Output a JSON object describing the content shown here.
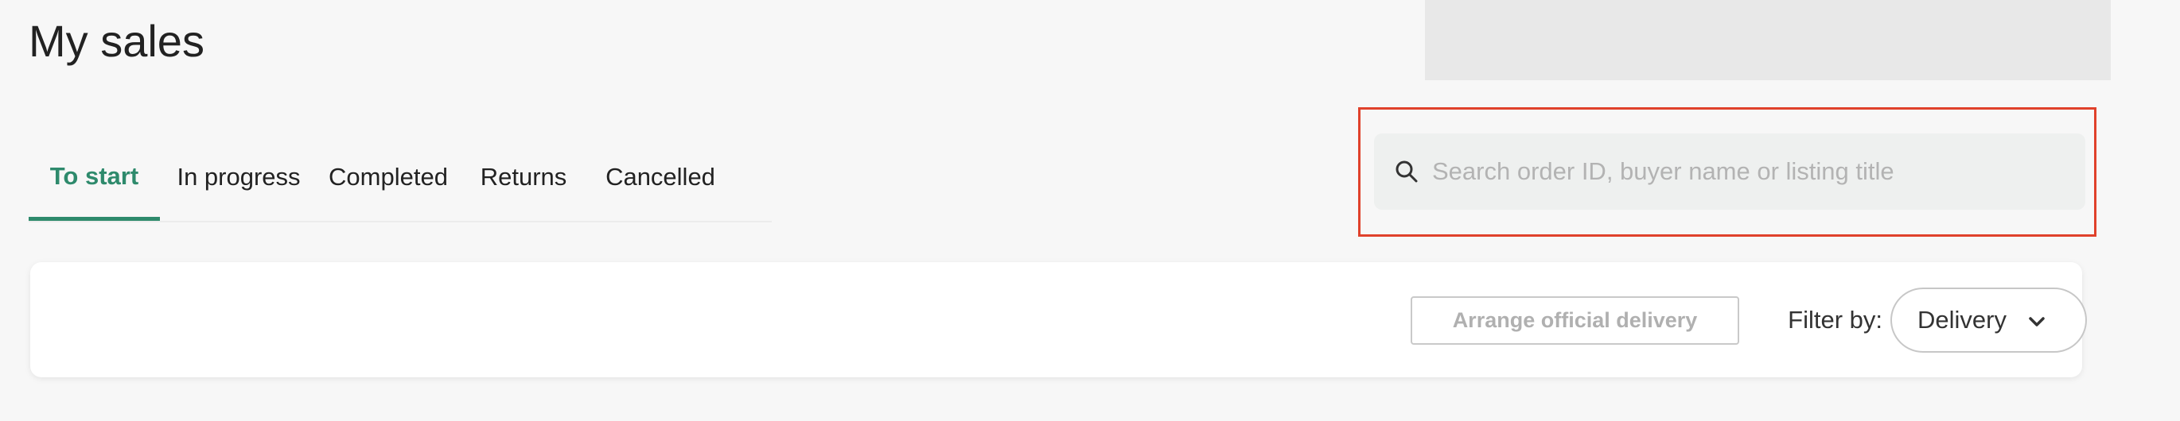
{
  "page": {
    "title": "My sales"
  },
  "tabs": [
    {
      "label": "To start",
      "active": true
    },
    {
      "label": "In progress",
      "active": false
    },
    {
      "label": "Completed",
      "active": false
    },
    {
      "label": "Returns",
      "active": false
    },
    {
      "label": "Cancelled",
      "active": false
    }
  ],
  "search": {
    "icon": "search-icon",
    "value": "",
    "placeholder": "Search order ID, buyer name or listing title"
  },
  "toolbar": {
    "arrange_label": "Arrange official delivery",
    "filter_label": "Filter by:",
    "filter_value": "Delivery",
    "filter_icon": "chevron-down-icon"
  },
  "colors": {
    "accent": "#2e8a6c",
    "highlight_border": "#e0412b",
    "background": "#f7f7f7",
    "card": "#ffffff"
  }
}
